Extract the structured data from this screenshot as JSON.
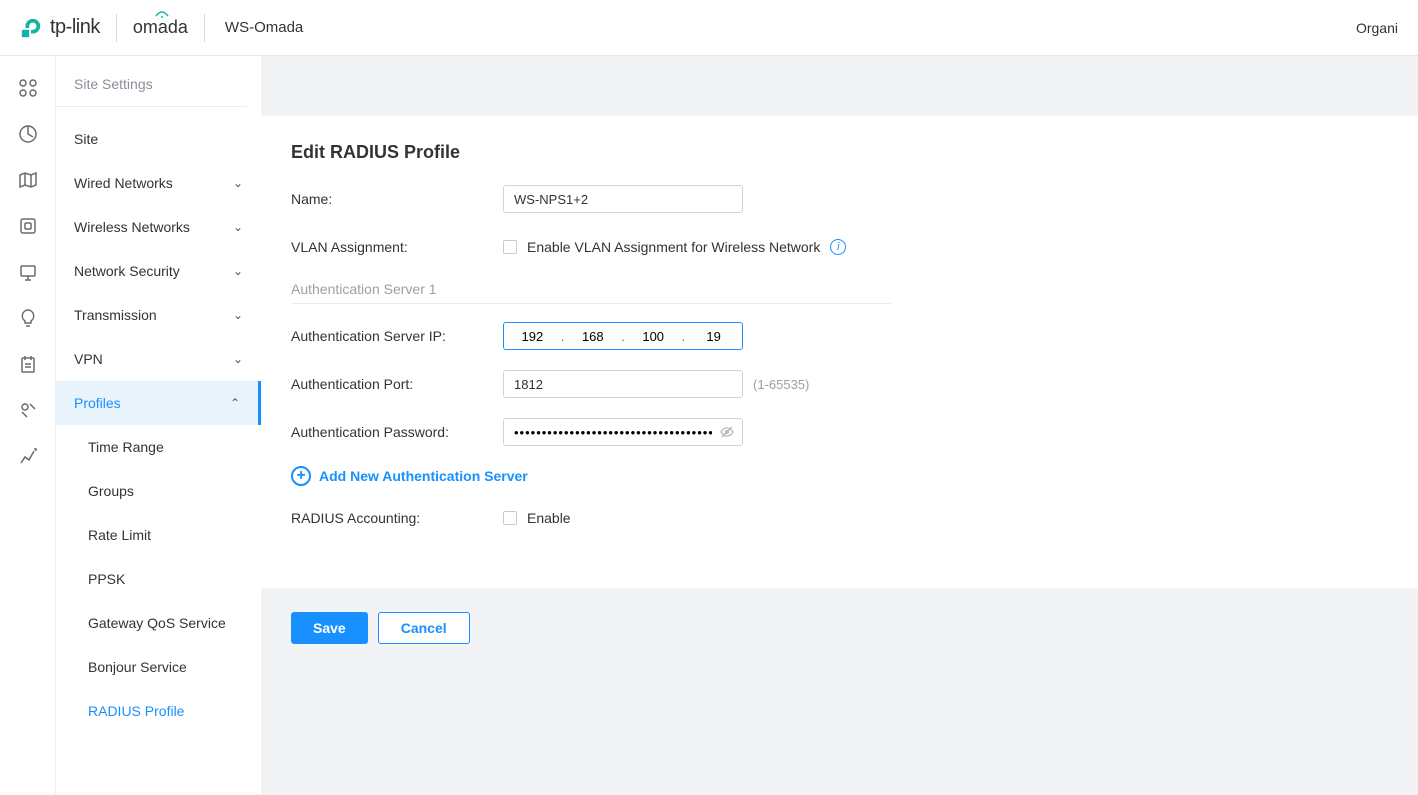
{
  "header": {
    "brand_tp": "tp-link",
    "brand_omada": "omada",
    "workspace": "WS-Omada",
    "right_text": "Organi"
  },
  "sidebar": {
    "heading": "Site Settings",
    "items": [
      {
        "label": "Site",
        "expandable": false
      },
      {
        "label": "Wired Networks",
        "expandable": true
      },
      {
        "label": "Wireless Networks",
        "expandable": true
      },
      {
        "label": "Network Security",
        "expandable": true
      },
      {
        "label": "Transmission",
        "expandable": true
      },
      {
        "label": "VPN",
        "expandable": true
      },
      {
        "label": "Profiles",
        "expandable": true
      }
    ],
    "sub_items": [
      {
        "label": "Time Range"
      },
      {
        "label": "Groups"
      },
      {
        "label": "Rate Limit"
      },
      {
        "label": "PPSK"
      },
      {
        "label": "Gateway QoS Service"
      },
      {
        "label": "Bonjour Service"
      },
      {
        "label": "RADIUS Profile"
      }
    ]
  },
  "form": {
    "title": "Edit RADIUS Profile",
    "labels": {
      "name": "Name:",
      "vlan": "VLAN Assignment:",
      "vlan_chk": "Enable VLAN Assignment for Wireless Network",
      "section1": "Authentication Server 1",
      "auth_ip": "Authentication Server IP:",
      "auth_port": "Authentication Port:",
      "port_hint": "(1-65535)",
      "auth_pwd": "Authentication Password:",
      "add_link": "Add New Authentication Server",
      "accounting": "RADIUS Accounting:",
      "acc_chk": "Enable"
    },
    "values": {
      "name": "WS-NPS1+2",
      "ip": [
        "192",
        "168",
        "100",
        "19"
      ],
      "port": "1812",
      "pwd_mask": "•••••••••••••••••••••••••••••••••••••••••••••"
    }
  },
  "buttons": {
    "save": "Save",
    "cancel": "Cancel"
  }
}
